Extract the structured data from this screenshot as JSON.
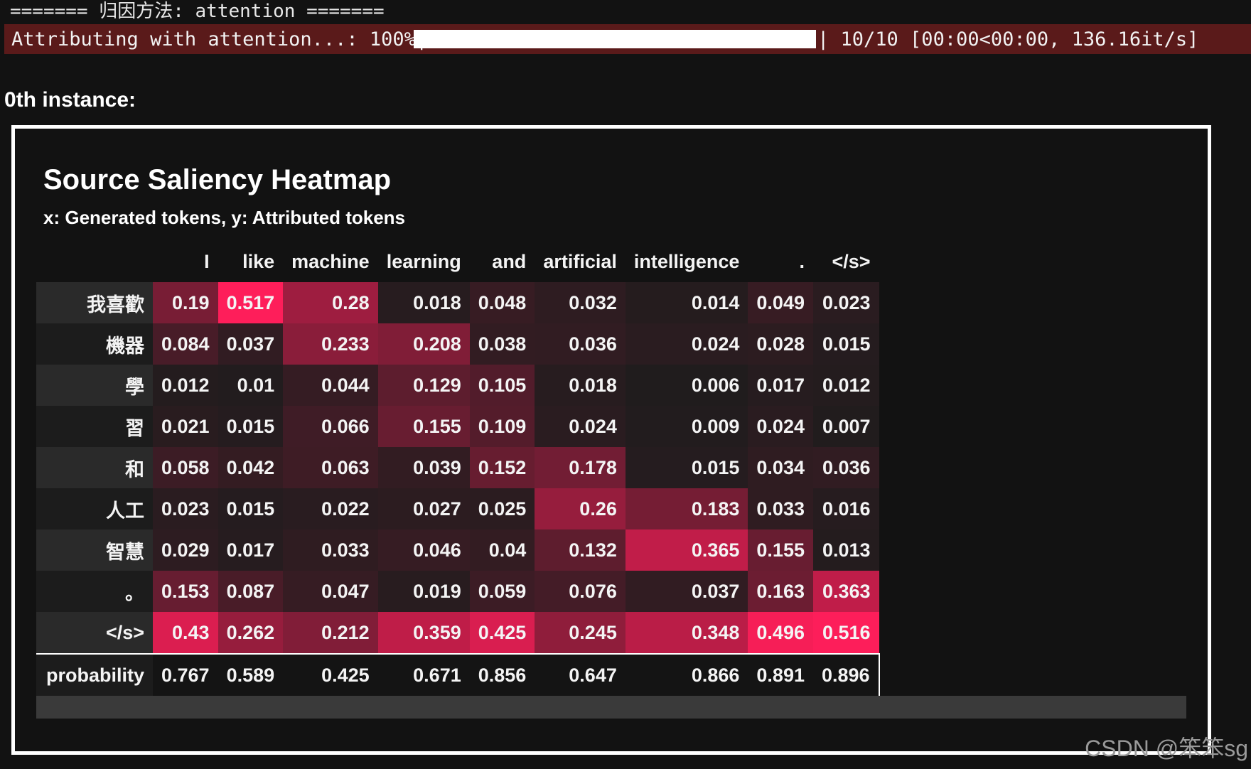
{
  "header_line": "======= 归因方法: attention =======",
  "progress": {
    "label": "Attributing with attention...: 100%|",
    "fraction": 1.0,
    "end_bar": "|",
    "status": " 10/10 [00:00<00:00, 136.16it/s]"
  },
  "instance_label": "0th instance:",
  "panel": {
    "title": "Source Saliency Heatmap",
    "subtitle": "x: Generated tokens, y: Attributed tokens"
  },
  "colors": {
    "low": "#1c1c1c",
    "high": "#ff1e5a",
    "background": "#121212",
    "progress_bg": "#5a1a1a"
  },
  "chart_data": {
    "type": "heatmap",
    "title": "Source Saliency Heatmap",
    "xlabel": "Generated tokens",
    "ylabel": "Attributed tokens",
    "columns": [
      "I",
      "like",
      "machine",
      "learning",
      "and",
      "artificial",
      "intelligence",
      ".",
      "</s>"
    ],
    "rows": [
      {
        "label": "我喜歡",
        "values": [
          0.19,
          0.517,
          0.28,
          0.018,
          0.048,
          0.032,
          0.014,
          0.049,
          0.023
        ]
      },
      {
        "label": "機器",
        "values": [
          0.084,
          0.037,
          0.233,
          0.208,
          0.038,
          0.036,
          0.024,
          0.028,
          0.015
        ]
      },
      {
        "label": "學",
        "values": [
          0.012,
          0.01,
          0.044,
          0.129,
          0.105,
          0.018,
          0.006,
          0.017,
          0.012
        ]
      },
      {
        "label": "習",
        "values": [
          0.021,
          0.015,
          0.066,
          0.155,
          0.109,
          0.024,
          0.009,
          0.024,
          0.007
        ]
      },
      {
        "label": "和",
        "values": [
          0.058,
          0.042,
          0.063,
          0.039,
          0.152,
          0.178,
          0.015,
          0.034,
          0.036
        ]
      },
      {
        "label": "人工",
        "values": [
          0.023,
          0.015,
          0.022,
          0.027,
          0.025,
          0.26,
          0.183,
          0.033,
          0.016
        ]
      },
      {
        "label": "智慧",
        "values": [
          0.029,
          0.017,
          0.033,
          0.046,
          0.04,
          0.132,
          0.365,
          0.155,
          0.013
        ]
      },
      {
        "label": "。",
        "values": [
          0.153,
          0.087,
          0.047,
          0.019,
          0.059,
          0.076,
          0.037,
          0.163,
          0.363
        ]
      },
      {
        "label": "</s>",
        "values": [
          0.43,
          0.262,
          0.212,
          0.359,
          0.425,
          0.245,
          0.348,
          0.496,
          0.516
        ]
      }
    ],
    "probability": {
      "label": "probability",
      "values": [
        0.767,
        0.589,
        0.425,
        0.671,
        0.856,
        0.647,
        0.866,
        0.891,
        0.896
      ]
    }
  },
  "watermark": "CSDN @笨笨sg"
}
